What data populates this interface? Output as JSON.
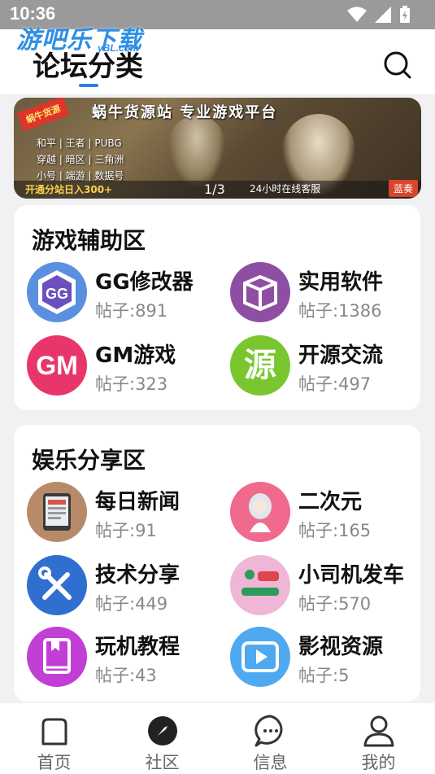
{
  "status": {
    "time": "10:36"
  },
  "watermark": {
    "text": "游吧乐下载",
    "sub": "yBL.com"
  },
  "header": {
    "title": "论坛分类"
  },
  "banner": {
    "top_text": "蜗牛货源站 专业游戏平台",
    "tag": "蜗牛货源",
    "left_lines": [
      "和平 | 王者 | PUBG",
      "穿越 | 暗区 | 三角洲",
      "小号 | 端游 | 数据号"
    ],
    "bottom_left": "开通分站日入300+",
    "counter": "1/3",
    "bottom_mid": "24小时在线客服",
    "badge": "蓝奏"
  },
  "sections": [
    {
      "title": "游戏辅助区",
      "items": [
        {
          "name": "GG修改器",
          "posts": "帖子:891",
          "icon": "gg-icon",
          "color": "#5b8fe0"
        },
        {
          "name": "实用软件",
          "posts": "帖子:1386",
          "icon": "box-icon",
          "color": "#8e4fa3"
        },
        {
          "name": "GM游戏",
          "posts": "帖子:323",
          "icon": "gm-icon",
          "color": "#e8366b"
        },
        {
          "name": "开源交流",
          "posts": "帖子:497",
          "icon": "yuan-icon",
          "color": "#79c62f"
        }
      ]
    },
    {
      "title": "娱乐分享区",
      "items": [
        {
          "name": "每日新闻",
          "posts": "帖子:91",
          "icon": "news-icon",
          "color": "#b98a6a"
        },
        {
          "name": "二次元",
          "posts": "帖子:165",
          "icon": "anime-icon",
          "color": "#f06a8d"
        },
        {
          "name": "技术分享",
          "posts": "帖子:449",
          "icon": "tools-icon",
          "color": "#2f6fd0"
        },
        {
          "name": "小司机发车",
          "posts": "帖子:570",
          "icon": "car-icon",
          "color": "#f0b6d5"
        },
        {
          "name": "玩机教程",
          "posts": "帖子:43",
          "icon": "book-icon",
          "color": "#c23fd6"
        },
        {
          "name": "影视资源",
          "posts": "帖子:5",
          "icon": "play-icon",
          "color": "#4ea9f0"
        }
      ]
    }
  ],
  "tabs": [
    {
      "label": "首页",
      "icon": "home-icon"
    },
    {
      "label": "社区",
      "icon": "compass-icon"
    },
    {
      "label": "信息",
      "icon": "message-icon"
    },
    {
      "label": "我的",
      "icon": "user-icon"
    }
  ]
}
